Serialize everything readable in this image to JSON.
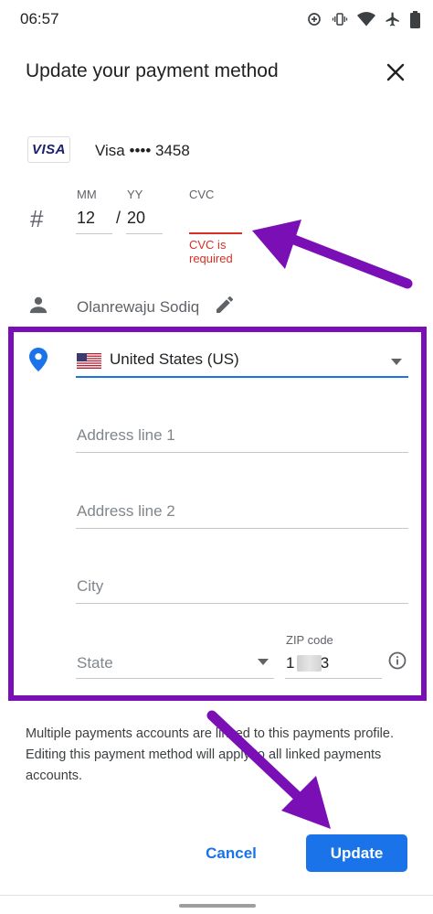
{
  "status_bar": {
    "time": "06:57",
    "icons": [
      "data-saver-icon",
      "vibrate-icon",
      "wifi-icon",
      "airplane-icon",
      "battery-icon"
    ]
  },
  "dialog": {
    "title": "Update your payment method"
  },
  "card": {
    "brand_logo": "VISA",
    "label": "Visa •••• 3458"
  },
  "expiry": {
    "mm_label": "MM",
    "mm_value": "12",
    "separator": "/",
    "yy_label": "YY",
    "yy_value": "20",
    "cvc_label": "CVC",
    "cvc_value": "",
    "cvc_error": "CVC is required"
  },
  "name": {
    "value": "Olanrewaju Sodiq"
  },
  "address": {
    "country": "United States (US)",
    "address_line1_placeholder": "Address line 1",
    "address_line2_placeholder": "Address line 2",
    "city_placeholder": "City",
    "state_placeholder": "State",
    "zip_label": "ZIP code",
    "zip_value": "1    23"
  },
  "info_text": "Multiple payments accounts are linked to this payments profile. Editing this payment method will apply to all linked payments accounts.",
  "actions": {
    "cancel_label": "Cancel",
    "update_label": "Update"
  },
  "colors": {
    "accent": "#1a73e8",
    "error": "#d93025",
    "annotation": "#7b0fb6"
  }
}
